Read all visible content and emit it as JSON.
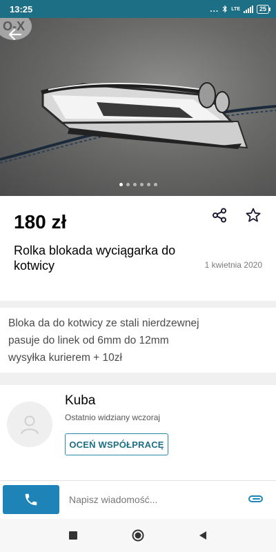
{
  "status_bar": {
    "time": "13:25",
    "notifications": "...",
    "network": "LTE",
    "battery": "25"
  },
  "gallery": {
    "logo_text": "O-X",
    "image_count": 6,
    "active_index": 0
  },
  "listing": {
    "price": "180 zł",
    "title": "Rolka blokada wyciągarka do kotwicy",
    "date": "1 kwietnia 2020"
  },
  "description": {
    "lines": [
      "Bloka da do kotwicy ze stali nierdzewnej",
      "pasuje do linek od 6mm do 12mm",
      "wysyłka kurierem + 10zł"
    ]
  },
  "seller": {
    "name": "Kuba",
    "last_seen": "Ostatnio widziany wczoraj",
    "rate_button": "OCEŃ WSPÓŁPRACĘ"
  },
  "message_bar": {
    "placeholder": "Napisz wiadomość..."
  },
  "colors": {
    "accent": "#1d6f86",
    "call_button": "#1e84b8",
    "status_bar": "#1d6f86"
  },
  "icons": {
    "back": "arrow-left-icon",
    "share": "share-icon",
    "favorite": "star-outline-icon",
    "call": "phone-icon",
    "attach": "paperclip-icon",
    "nav_recent": "square-icon",
    "nav_home": "circle-icon",
    "nav_back": "triangle-back-icon"
  }
}
